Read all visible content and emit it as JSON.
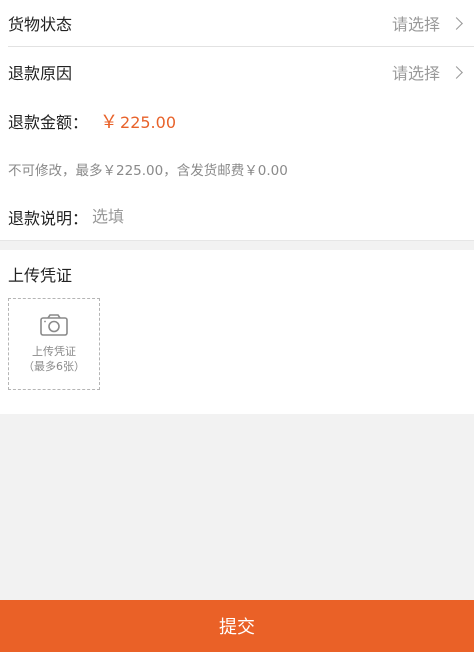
{
  "form": {
    "goods_status_label": "货物状态",
    "goods_status_value": "请选择",
    "refund_reason_label": "退款原因",
    "refund_reason_value": "请选择",
    "refund_amount_label": "退款金额：",
    "refund_amount_currency": "￥",
    "refund_amount_value": "225.00",
    "amount_hint": "不可修改，最多￥225.00，含发货邮费￥0.00",
    "refund_explain_label": "退款说明：",
    "refund_explain_placeholder": "选填"
  },
  "upload": {
    "title": "上传凭证",
    "box_line1": "上传凭证",
    "box_line2": "（最多6张）"
  },
  "footer": {
    "submit_label": "提交"
  },
  "colors": {
    "accent": "#ea6127",
    "amount": "#e8622a"
  },
  "icons": [
    "chevron-right-icon",
    "camera-icon"
  ]
}
